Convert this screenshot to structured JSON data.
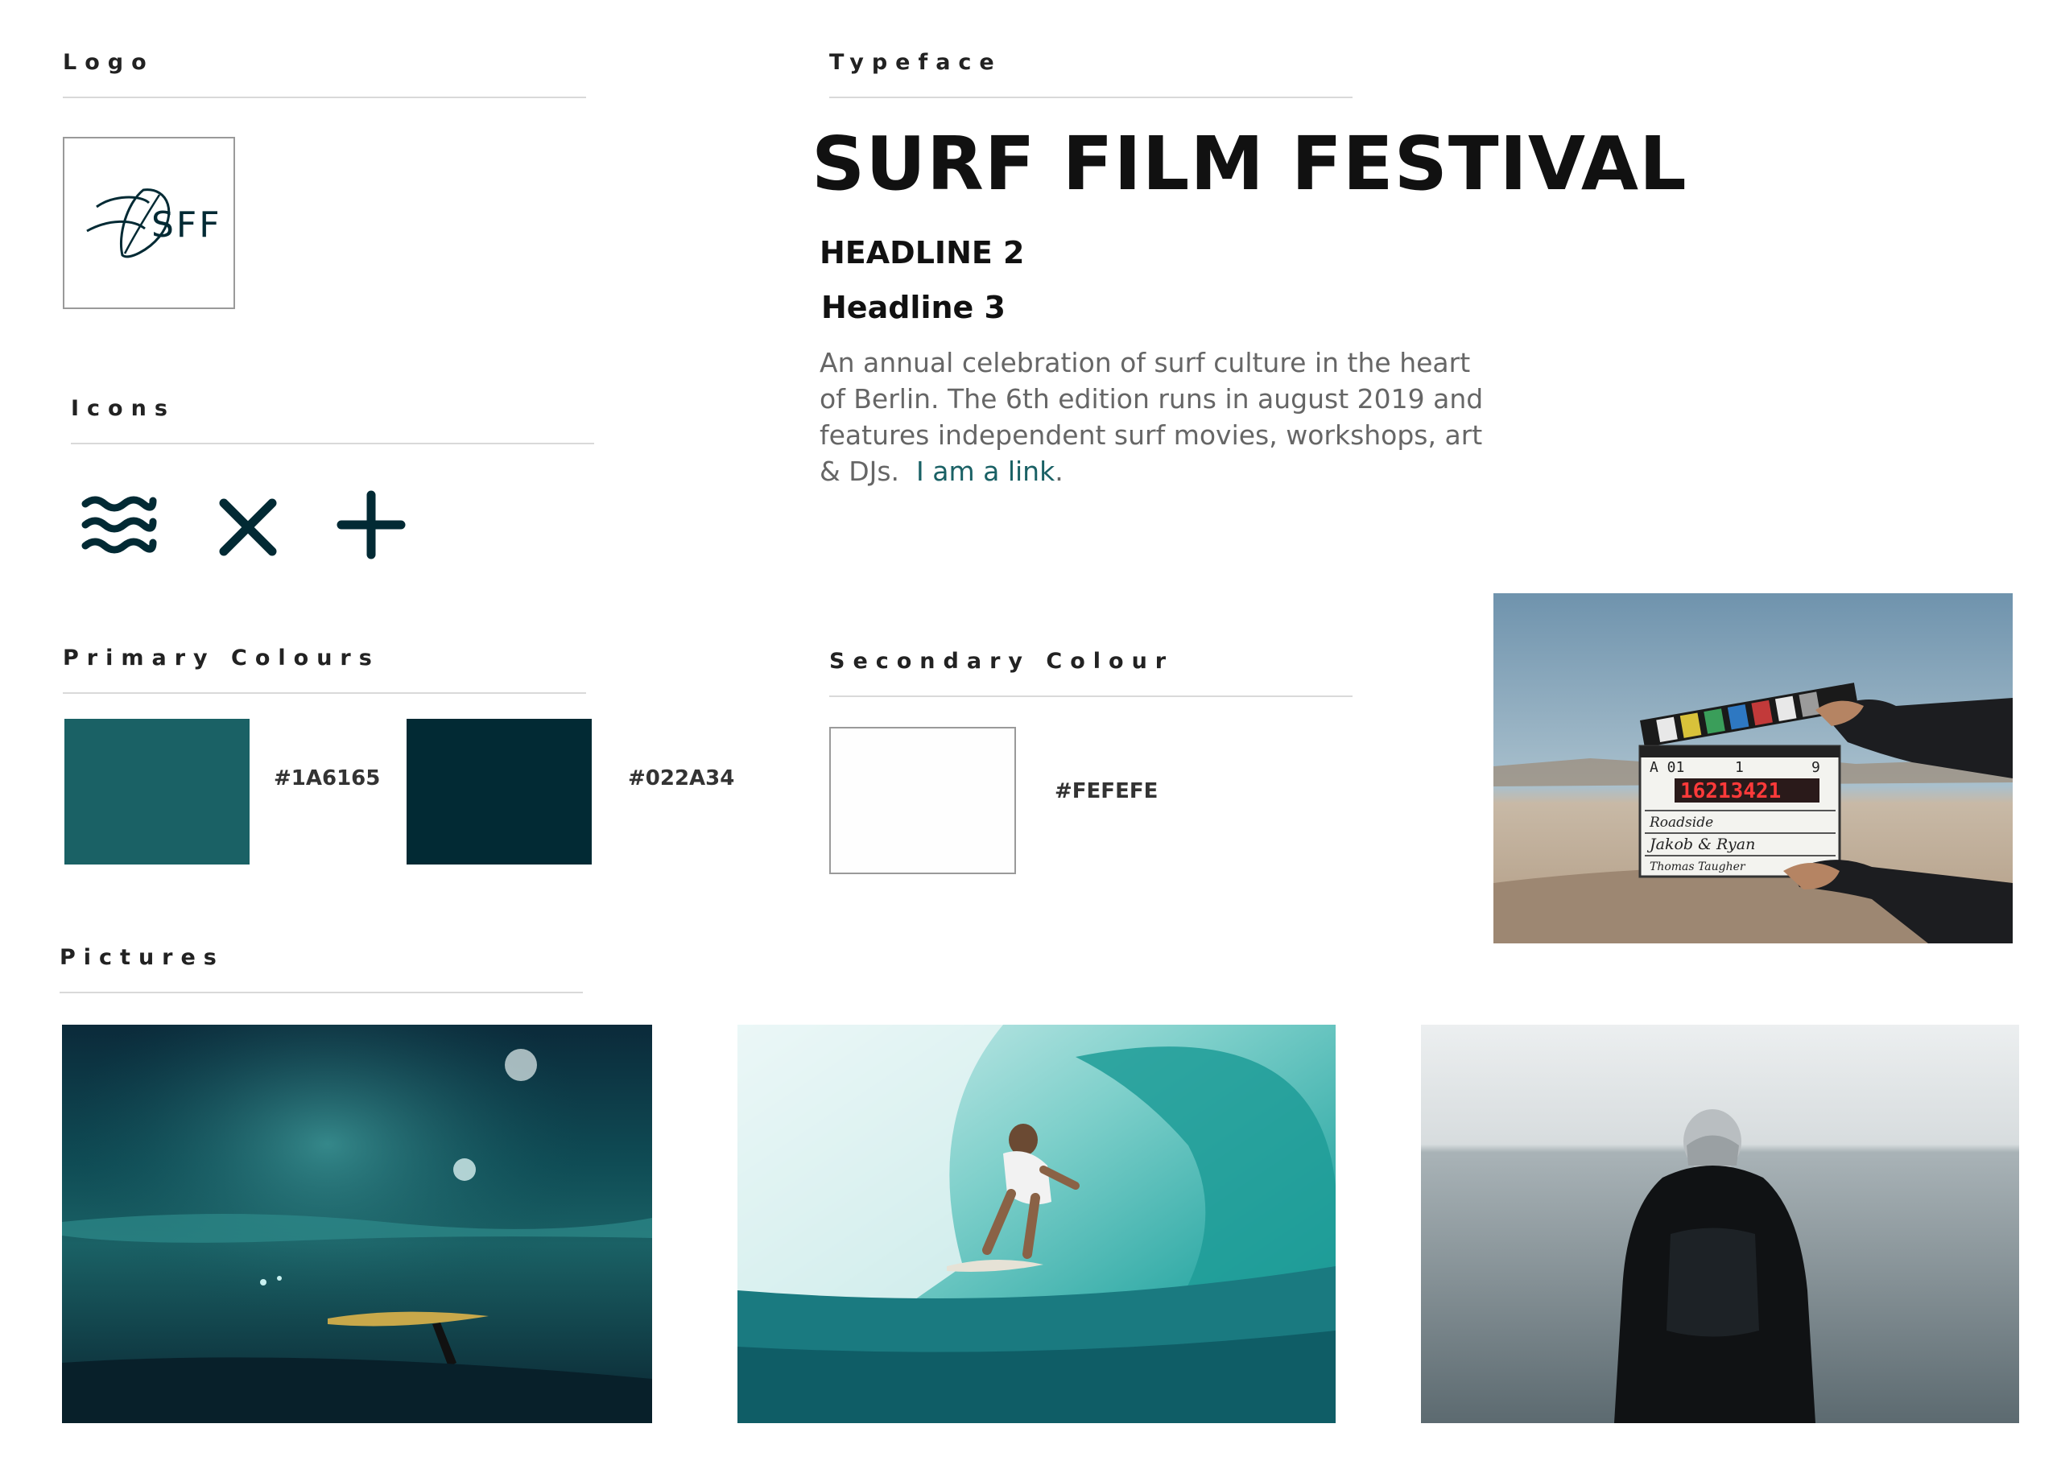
{
  "sections": {
    "logo": "Logo",
    "typeface": "Typeface",
    "icons": "Icons",
    "primary_colours": "Primary Colours",
    "secondary_colour": "Secondary Colour",
    "pictures": "Pictures"
  },
  "logo": {
    "text": "SFF"
  },
  "typeface": {
    "headline1": "SURF FILM FESTIVAL",
    "headline2": "HEADLINE 2",
    "headline3": "Headline 3",
    "body": "An annual celebration of surf culture in the heart of Berlin. The 6th edition runs in august 2019 and features independent surf movies, workshops, art & DJs.",
    "link": "I am a link",
    "link_suffix": "."
  },
  "icons": [
    "waves-icon",
    "close-icon",
    "plus-icon"
  ],
  "colors": {
    "primary": [
      {
        "hex": "#1A6165",
        "value": "#1A6165"
      },
      {
        "hex": "#022A34",
        "value": "#022A34"
      }
    ],
    "secondary": [
      {
        "hex": "#FEFEFE",
        "value": "#FEFEFE"
      }
    ]
  },
  "clapper": {
    "scene_a": "A 01",
    "scene_b": "1",
    "take": "9",
    "timecode": "16213421",
    "line1": "Roadside",
    "line2": "Jakob & Ryan",
    "line3": "Thomas Taugher"
  },
  "pictures": [
    "underwater-surfboard",
    "surfer-in-barrel-wave",
    "person-facing-sea"
  ]
}
